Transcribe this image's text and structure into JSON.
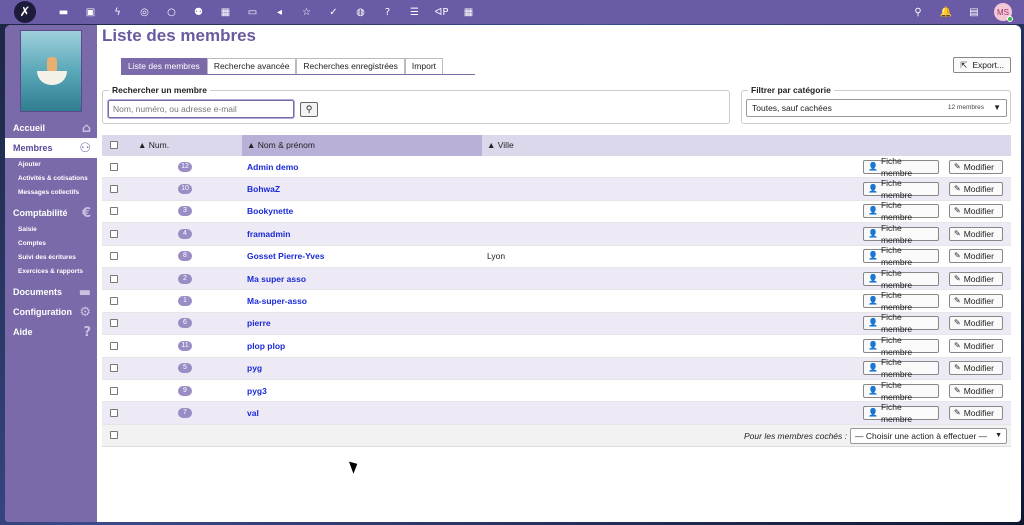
{
  "topbar": {
    "logo": "✗",
    "icons": [
      "folder-icon",
      "image-icon",
      "bolt-icon",
      "chat-icon",
      "circle-icon",
      "users-icon",
      "calendar-icon",
      "inbox-icon",
      "megaphone-icon",
      "star-icon",
      "check-icon",
      "globe-icon",
      "help-icon",
      "list-icon",
      "php-icon",
      "table-icon"
    ],
    "icon_glyphs": [
      "▬",
      "▣",
      "ϟ",
      "◎",
      "○",
      "⚉",
      "▦",
      "▭",
      "◂",
      "☆",
      "✓",
      "◍",
      "?",
      "☰",
      "ᐊP",
      "▦"
    ],
    "right_glyphs": [
      "⚲",
      "🔔",
      "▤"
    ],
    "avatar": "MS"
  },
  "sidebar": {
    "items": [
      {
        "label": "Accueil",
        "icon": "⌂",
        "active": false
      },
      {
        "label": "Membres",
        "icon": "⚇",
        "active": true,
        "sub": [
          "Ajouter",
          "Activités & cotisations",
          "Messages collectifs"
        ]
      },
      {
        "label": "Comptabilité",
        "icon": "€",
        "active": false,
        "sub": [
          "Saisie",
          "Comptes",
          "Suivi des écritures",
          "Exercices & rapports"
        ]
      },
      {
        "label": "Documents",
        "icon": "▬",
        "active": false
      },
      {
        "label": "Configuration",
        "icon": "⚙",
        "active": false
      },
      {
        "label": "Aide",
        "icon": "?",
        "active": false
      }
    ]
  },
  "page": {
    "title": "Liste des membres",
    "tabs": [
      "Liste des membres",
      "Recherche avancée",
      "Recherches enregistrées",
      "Import"
    ],
    "export_label": "Export..."
  },
  "search": {
    "legend": "Rechercher un membre",
    "placeholder": "Nom, numéro, ou adresse e-mail"
  },
  "filter": {
    "legend": "Filtrer par catégorie",
    "selected": "Toutes, sauf cachées",
    "count": "12 membres"
  },
  "table": {
    "headers": {
      "num": "Num.",
      "name": "Nom & prénom",
      "city": "Ville"
    },
    "fiche_label": "Fiche membre",
    "modify_label": "Modifier",
    "rows": [
      {
        "num": "12",
        "name": "Admin demo",
        "city": ""
      },
      {
        "num": "10",
        "name": "BohwaZ",
        "city": ""
      },
      {
        "num": "3",
        "name": "Bookynette",
        "city": ""
      },
      {
        "num": "4",
        "name": "framadmin",
        "city": ""
      },
      {
        "num": "8",
        "name": "Gosset Pierre-Yves",
        "city": "Lyon"
      },
      {
        "num": "2",
        "name": "Ma super asso",
        "city": ""
      },
      {
        "num": "1",
        "name": "Ma-super-asso",
        "city": ""
      },
      {
        "num": "6",
        "name": "pierre",
        "city": ""
      },
      {
        "num": "11",
        "name": "plop plop",
        "city": ""
      },
      {
        "num": "5",
        "name": "pyg",
        "city": ""
      },
      {
        "num": "9",
        "name": "pyg3",
        "city": ""
      },
      {
        "num": "7",
        "name": "val",
        "city": ""
      }
    ],
    "footer_label": "Pour les membres cochés :",
    "action_placeholder": "— Choisir une action à effectuer —"
  },
  "colors": {
    "accent": "#7a6aaa",
    "link": "#1a2ad6"
  }
}
